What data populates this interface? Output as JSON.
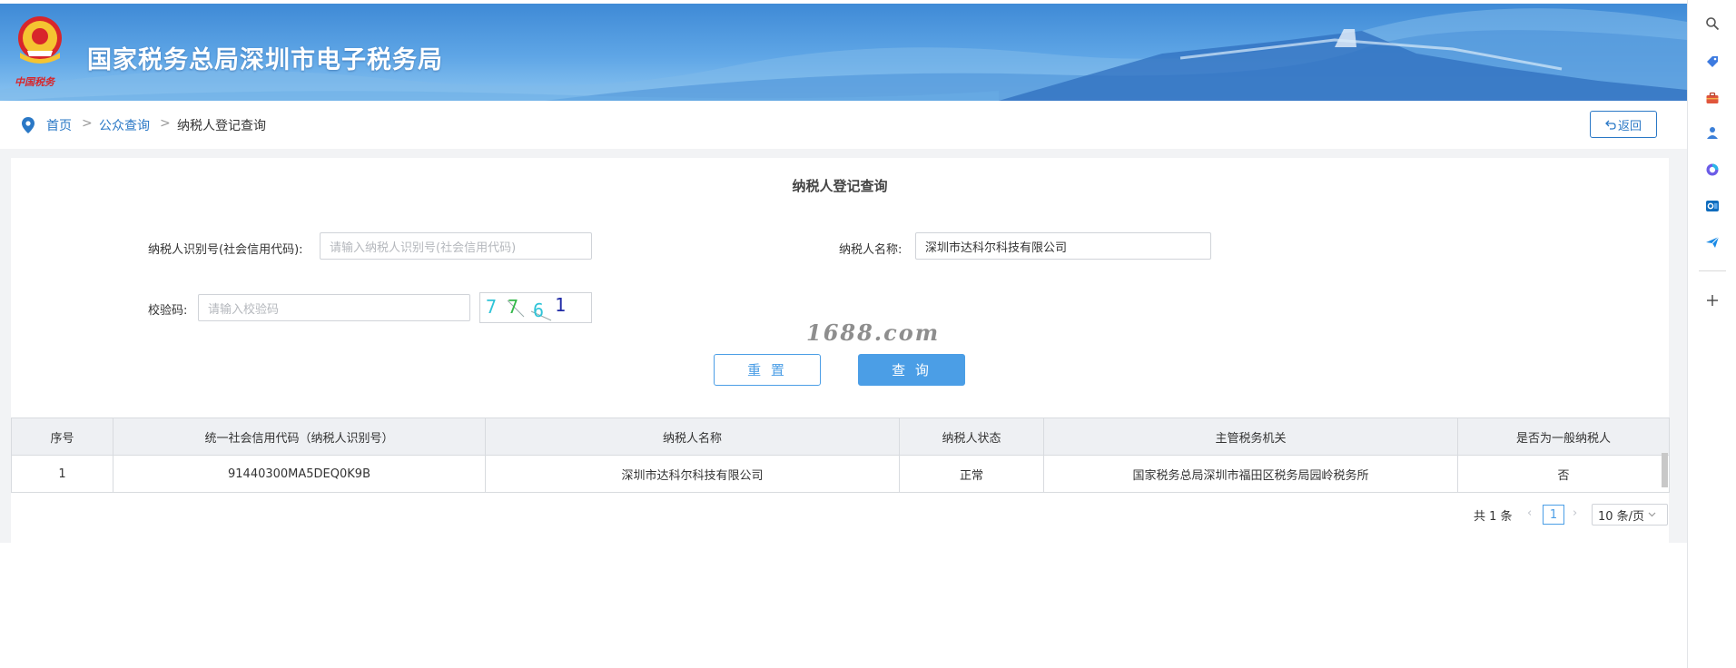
{
  "header": {
    "site_title": "国家税务总局深圳市电子税务局",
    "emblem_caption": "中国税务"
  },
  "breadcrumb": {
    "items": [
      "首页",
      "公众查询",
      "纳税人登记查询"
    ],
    "separator": ">",
    "back_label": "返回"
  },
  "form": {
    "title": "纳税人登记查询",
    "taxpayer_id_label": "纳税人识别号(社会信用代码):",
    "taxpayer_id_placeholder": "请输入纳税人识别号(社会信用代码)",
    "taxpayer_id_value": "",
    "taxpayer_name_label": "纳税人名称:",
    "taxpayer_name_value": "深圳市达科尔科技有限公司",
    "captcha_label": "校验码:",
    "captcha_placeholder": "请输入校验码",
    "captcha_chars": [
      "7",
      "7",
      "6",
      "1"
    ],
    "captcha_colors": [
      "#2fc4d8",
      "#34b84a",
      "#2fc4d8",
      "#1f2aa6"
    ],
    "watermark": "1688.com",
    "reset_label": "重 置",
    "query_label": "查 询"
  },
  "table": {
    "headers": [
      "序号",
      "统一社会信用代码（纳税人识别号）",
      "纳税人名称",
      "纳税人状态",
      "主管税务机关",
      "是否为一般纳税人"
    ],
    "rows": [
      [
        "1",
        "91440300MA5DEQ0K9B",
        "深圳市达科尔科技有限公司",
        "正常",
        "国家税务总局深圳市福田区税务局园岭税务所",
        "否"
      ]
    ]
  },
  "pagination": {
    "total_text": "共 1 条",
    "current_page": "1",
    "page_size": "10 条/页"
  },
  "sidebar_icons": [
    "search-icon",
    "tag-icon",
    "briefcase-icon",
    "user-icon",
    "copilot-icon",
    "outlook-icon",
    "send-icon",
    "plus-icon"
  ],
  "colors": {
    "accent": "#4b9ee6",
    "link": "#2a78c6",
    "banner": "#3f8ad6"
  }
}
